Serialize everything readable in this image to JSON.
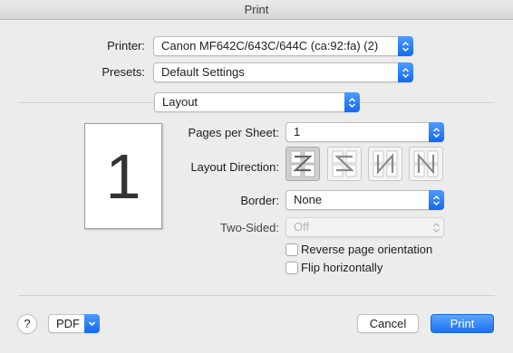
{
  "window": {
    "title": "Print"
  },
  "printer": {
    "label": "Printer:",
    "value": "Canon MF642C/643C/644C (ca:92:fa) (2)"
  },
  "presets": {
    "label": "Presets:",
    "value": "Default Settings"
  },
  "section": {
    "value": "Layout"
  },
  "preview": {
    "page_number": "1"
  },
  "layout": {
    "pages_per_sheet": {
      "label": "Pages per Sheet:",
      "value": "1"
    },
    "layout_direction": {
      "label": "Layout Direction:",
      "options": [
        "z",
        "reverse-z",
        "n-down",
        "reverse-n"
      ]
    },
    "border": {
      "label": "Border:",
      "value": "None"
    },
    "two_sided": {
      "label": "Two-Sided:",
      "value": "Off"
    },
    "reverse_orientation": {
      "label": "Reverse page orientation",
      "checked": false
    },
    "flip_horizontally": {
      "label": "Flip horizontally",
      "checked": false
    }
  },
  "footer": {
    "help": "?",
    "pdf": "PDF",
    "cancel": "Cancel",
    "print": "Print"
  },
  "colors": {
    "accent": "#1e6ff2",
    "background": "#ececec"
  }
}
